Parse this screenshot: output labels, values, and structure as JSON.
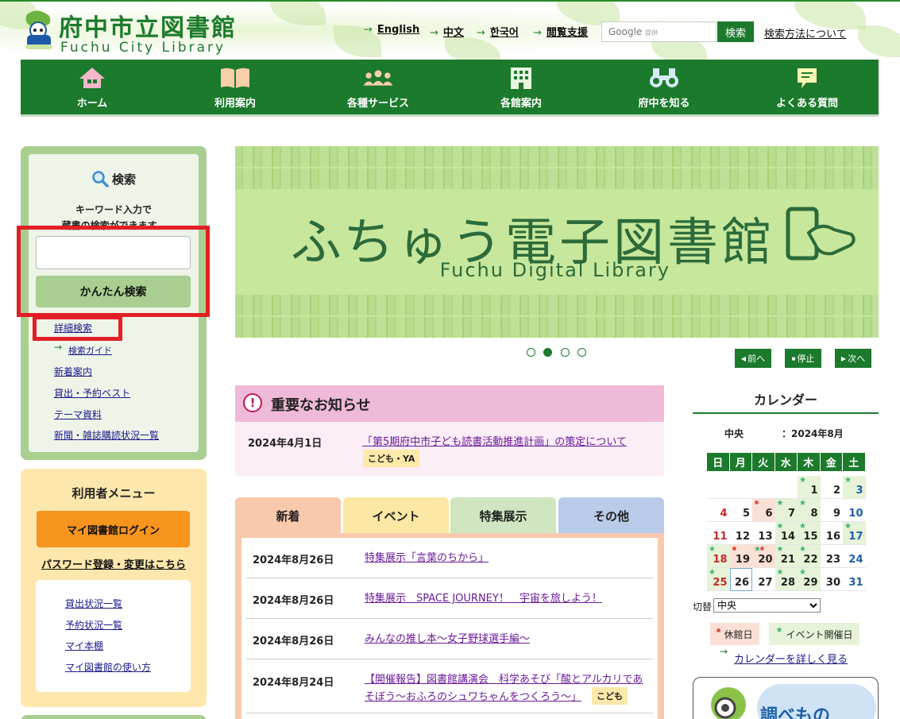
{
  "header": {
    "logo_ja": "府中市立図書館",
    "logo_en": "Fuchu City Library",
    "links": [
      "English",
      "中文",
      "한국어",
      "閲覧支援"
    ],
    "google_label": "Google",
    "google_sub": "提供",
    "search_button": "検索",
    "search_method": "検索方法について"
  },
  "nav": [
    "ホーム",
    "利用案内",
    "各種サービス",
    "各館案内",
    "府中を知る",
    "よくある質問"
  ],
  "search": {
    "title": "検索",
    "desc_line1": "キーワード入力で",
    "desc_line2": "蔵書の検索ができます。",
    "input_value": "",
    "button": "かんたん検索",
    "links": [
      "詳細検索",
      "検索ガイド",
      "新着案内",
      "貸出・予約ベスト",
      "テーマ資料",
      "新聞・雑誌購読状況一覧"
    ]
  },
  "user_menu": {
    "title": "利用者メニュー",
    "login": "マイ図書館ログイン",
    "password": "パスワード登録・変更はこちら",
    "links": [
      "貸出状況一覧",
      "予約状況一覧",
      "マイ本棚",
      "マイ図書館の使い方"
    ]
  },
  "banner": {
    "title": "ふちゅう電子図書館",
    "subtitle": "Fuchu Digital Library",
    "prev": "前へ",
    "stop": "停止",
    "next": "次へ"
  },
  "notice": {
    "title": "重要なお知らせ",
    "date": "2024年4月1日",
    "link": "「第5期府中市子ども読書活動推進計画」の策定について",
    "tag": "こども・YA"
  },
  "tabs": [
    "新着",
    "イベント",
    "特集展示",
    "その他"
  ],
  "news": [
    {
      "date": "2024年8月26日",
      "text": "特集展示「言葉のちから」"
    },
    {
      "date": "2024年8月26日",
      "text": "特集展示　SPACE JOURNEY！　宇宙を旅しよう！"
    },
    {
      "date": "2024年8月26日",
      "text": "みんなの推し本～女子野球選手編～"
    },
    {
      "date": "2024年8月24日",
      "text": "【開催報告】図書館講演会　科学あそび「酸とアルカリであ",
      "text2": "そぼう～おふろのシュワちゃんをつくろう～」",
      "tag": "こども"
    }
  ],
  "calendar": {
    "title": "カレンダー",
    "branch": "中央",
    "month": "：2024年8月",
    "weekdays": [
      "日",
      "月",
      "火",
      "水",
      "木",
      "金",
      "土"
    ],
    "switch_label": "切替",
    "switch_value": "中央",
    "legend_closed": "休館日",
    "legend_event": "イベント開催日",
    "more": "カレンダーを詳しく見る"
  },
  "shirabe": "調べもの",
  "colors": {
    "green": "#1c7a2c",
    "light_green": "#a9cf90",
    "yellow": "#fde7ac",
    "orange": "#f7941d",
    "pink": "#efb9d8",
    "alert_red": "#e21f26"
  }
}
